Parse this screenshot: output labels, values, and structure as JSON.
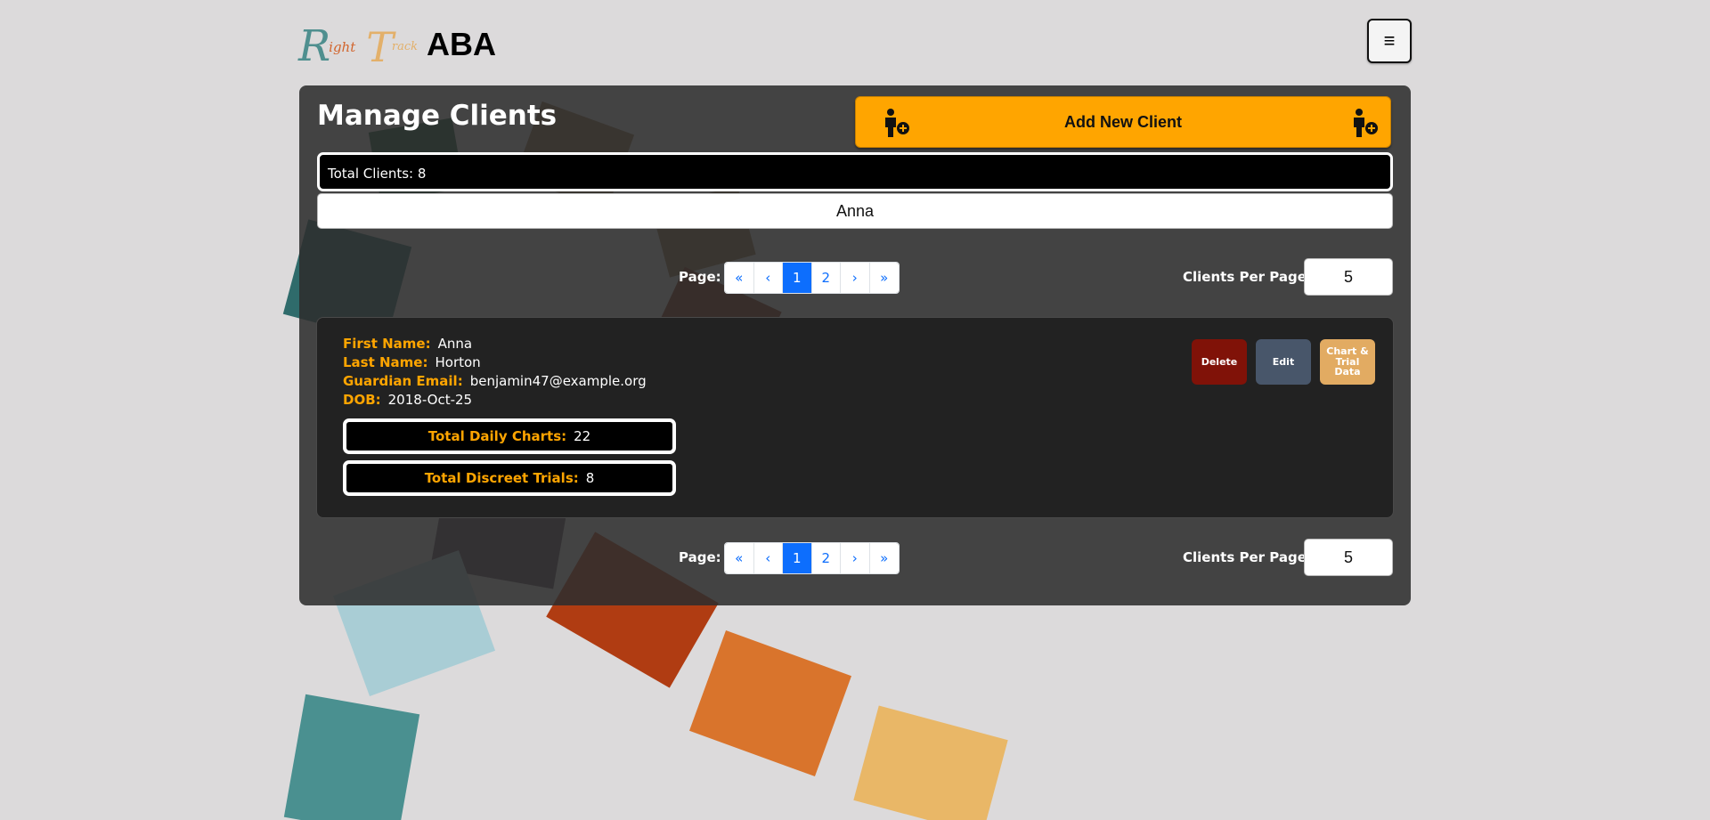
{
  "header": {
    "logo": {
      "big_r": "R",
      "small_r": "ight",
      "big_t": "T",
      "small_t": "rack",
      "aba": "ABA"
    },
    "menu_glyph": "≡"
  },
  "page": {
    "title": "Manage Clients",
    "add_button_label": "Add New Client",
    "add_button_icon": "person-add-icon",
    "total_clients_label": "Total Clients: 8",
    "search_value": "Anna"
  },
  "pagination": {
    "page_label": "Page:",
    "first": "«",
    "prev": "‹",
    "pages": [
      "1",
      "2"
    ],
    "current_page": "1",
    "next": "›",
    "last": "»",
    "per_page_label": "Clients Per Page:",
    "per_page_value": "5"
  },
  "client": {
    "first_name_label": "First Name:",
    "first_name": "Anna",
    "last_name_label": "Last Name:",
    "last_name": "Horton",
    "guardian_email_label": "Guardian Email:",
    "guardian_email": "benjamin47@example.org",
    "dob_label": "DOB:",
    "dob": "2018-Oct-25",
    "daily_charts_label": "Total Daily Charts:",
    "daily_charts": "22",
    "discreet_trials_label": "Total Discreet Trials:",
    "discreet_trials": "8",
    "delete_label": "Delete",
    "edit_label": "Edit",
    "chart_label": "Chart & Trial Data"
  },
  "colors": {
    "accent": "#ffa500",
    "delete": "#801208",
    "edit": "#48566a",
    "chart": "#e2ab62",
    "pager_active": "#0d6efd"
  }
}
